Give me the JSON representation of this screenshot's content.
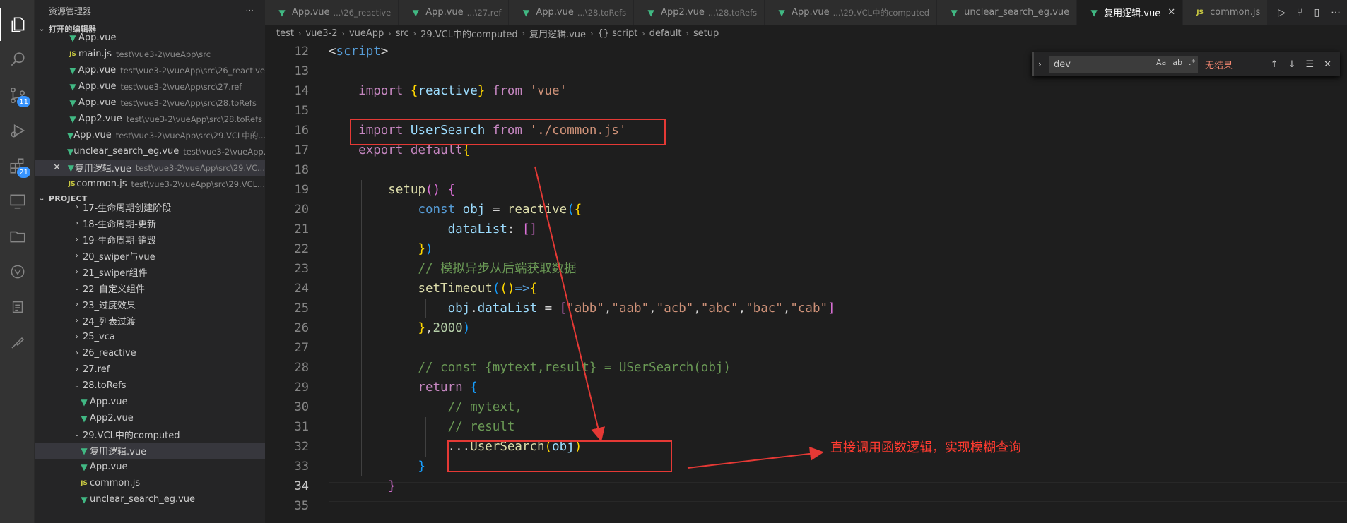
{
  "sidebar": {
    "title": "资源管理器",
    "more": "···",
    "open_editors_label": "打开的编辑器",
    "project_label": "PROJECT",
    "open_editors": [
      {
        "icon": "vue",
        "name": "App.vue",
        "desc": ""
      },
      {
        "icon": "js",
        "name": "main.js",
        "desc": "test\\vue3-2\\vueApp\\src"
      },
      {
        "icon": "vue",
        "name": "App.vue",
        "desc": "test\\vue3-2\\vueApp\\src\\26_reactive"
      },
      {
        "icon": "vue",
        "name": "App.vue",
        "desc": "test\\vue3-2\\vueApp\\src\\27.ref"
      },
      {
        "icon": "vue",
        "name": "App.vue",
        "desc": "test\\vue3-2\\vueApp\\src\\28.toRefs"
      },
      {
        "icon": "vue",
        "name": "App2.vue",
        "desc": "test\\vue3-2\\vueApp\\src\\28.toRefs"
      },
      {
        "icon": "vue",
        "name": "App.vue",
        "desc": "test\\vue3-2\\vueApp\\src\\29.VCL中的..."
      },
      {
        "icon": "vue",
        "name": "unclear_search_eg.vue",
        "desc": "test\\vue3-2\\vueApp..."
      },
      {
        "icon": "vue",
        "name": "复用逻辑.vue",
        "desc": "test\\vue3-2\\vueApp\\src\\29.VC..."
      },
      {
        "icon": "js",
        "name": "common.js",
        "desc": "test\\vue3-2\\vueApp\\src\\29.VCL..."
      }
    ],
    "project_items": [
      {
        "type": "folder",
        "name": "17-生命周期创建阶段",
        "indent": 1
      },
      {
        "type": "folder",
        "name": "18-生命周期-更新",
        "indent": 1
      },
      {
        "type": "folder",
        "name": "19-生命周期-销毁",
        "indent": 1
      },
      {
        "type": "folder",
        "name": "20_swiper与vue",
        "indent": 1
      },
      {
        "type": "folder",
        "name": "21_swiper组件",
        "indent": 1
      },
      {
        "type": "folder-open",
        "name": "22_自定义组件",
        "indent": 1
      },
      {
        "type": "folder",
        "name": "23_过度效果",
        "indent": 1
      },
      {
        "type": "folder",
        "name": "24_列表过渡",
        "indent": 1
      },
      {
        "type": "folder",
        "name": "25_vca",
        "indent": 1
      },
      {
        "type": "folder",
        "name": "26_reactive",
        "indent": 1
      },
      {
        "type": "folder",
        "name": "27.ref",
        "indent": 1
      },
      {
        "type": "folder-open",
        "name": "28.toRefs",
        "indent": 1
      },
      {
        "type": "vue",
        "name": "App.vue",
        "indent": 2
      },
      {
        "type": "vue",
        "name": "App2.vue",
        "indent": 2
      },
      {
        "type": "folder-open",
        "name": "29.VCL中的computed",
        "indent": 1
      },
      {
        "type": "vue",
        "name": "复用逻辑.vue",
        "indent": 2
      },
      {
        "type": "vue",
        "name": "App.vue",
        "indent": 2
      },
      {
        "type": "js",
        "name": "common.js",
        "indent": 2
      },
      {
        "type": "vue",
        "name": "unclear_search_eg.vue",
        "indent": 2
      }
    ]
  },
  "activity": {
    "scm_badge": "11",
    "ext_badge": "21"
  },
  "tabs": [
    {
      "icon": "vue",
      "name": "App.vue",
      "desc": "...\\26_reactive",
      "active": false
    },
    {
      "icon": "vue",
      "name": "App.vue",
      "desc": "...\\27.ref",
      "active": false
    },
    {
      "icon": "vue",
      "name": "App.vue",
      "desc": "...\\28.toRefs",
      "active": false
    },
    {
      "icon": "vue",
      "name": "App2.vue",
      "desc": "...\\28.toRefs",
      "active": false
    },
    {
      "icon": "vue",
      "name": "App.vue",
      "desc": "...\\29.VCL中的computed",
      "active": false
    },
    {
      "icon": "vue",
      "name": "unclear_search_eg.vue",
      "desc": "",
      "active": false
    },
    {
      "icon": "vue",
      "name": "复用逻辑.vue",
      "desc": "",
      "active": true,
      "close": "✕"
    },
    {
      "icon": "js",
      "name": "common.js",
      "desc": "",
      "active": false
    }
  ],
  "breadcrumb": [
    "test",
    "vue3-2",
    "vueApp",
    "src",
    "29.VCL中的computed",
    "复用逻辑.vue",
    "{} script",
    "default",
    "setup"
  ],
  "find": {
    "value": "dev",
    "result": "无结果",
    "opt_case": "Aa",
    "opt_word": "ab",
    "opt_regex": ".*"
  },
  "editor": {
    "line_numbers": [
      "12",
      "13",
      "14",
      "15",
      "16",
      "17",
      "18",
      "19",
      "20",
      "21",
      "22",
      "23",
      "24",
      "25",
      "26",
      "27",
      "28",
      "29",
      "30",
      "31",
      "32",
      "33",
      "34",
      "35"
    ],
    "current_line": "34",
    "lines": [
      [
        {
          "t": "w",
          "x": "<"
        },
        {
          "t": "kb",
          "x": "script"
        },
        {
          "t": "w",
          "x": ">"
        }
      ],
      [],
      [
        {
          "t": "w",
          "x": "    "
        },
        {
          "t": "k",
          "x": "import"
        },
        {
          "t": "w",
          "x": " "
        },
        {
          "t": "y",
          "x": "{"
        },
        {
          "t": "v",
          "x": "reactive"
        },
        {
          "t": "y",
          "x": "}"
        },
        {
          "t": "w",
          "x": " "
        },
        {
          "t": "k",
          "x": "from"
        },
        {
          "t": "w",
          "x": " "
        },
        {
          "t": "s",
          "x": "'vue'"
        }
      ],
      [],
      [
        {
          "t": "w",
          "x": "    "
        },
        {
          "t": "k",
          "x": "import"
        },
        {
          "t": "w",
          "x": " "
        },
        {
          "t": "v",
          "x": "UserSearch"
        },
        {
          "t": "w",
          "x": " "
        },
        {
          "t": "k",
          "x": "from"
        },
        {
          "t": "w",
          "x": " "
        },
        {
          "t": "s",
          "x": "'./common.js'"
        }
      ],
      [
        {
          "t": "w",
          "x": "    "
        },
        {
          "t": "k",
          "x": "export"
        },
        {
          "t": "w",
          "x": " "
        },
        {
          "t": "k",
          "x": "default"
        },
        {
          "t": "y",
          "x": "{"
        }
      ],
      [],
      [
        {
          "t": "w",
          "x": "        "
        },
        {
          "t": "f",
          "x": "setup"
        },
        {
          "t": "pk",
          "x": "()"
        },
        {
          "t": "w",
          "x": " "
        },
        {
          "t": "pk",
          "x": "{"
        }
      ],
      [
        {
          "t": "w",
          "x": "            "
        },
        {
          "t": "kb",
          "x": "const"
        },
        {
          "t": "w",
          "x": " "
        },
        {
          "t": "v",
          "x": "obj"
        },
        {
          "t": "w",
          "x": " = "
        },
        {
          "t": "f",
          "x": "reactive"
        },
        {
          "t": "b",
          "x": "("
        },
        {
          "t": "y",
          "x": "{"
        }
      ],
      [
        {
          "t": "w",
          "x": "                "
        },
        {
          "t": "v",
          "x": "dataList"
        },
        {
          "t": "w",
          "x": ": "
        },
        {
          "t": "pk",
          "x": "[]"
        }
      ],
      [
        {
          "t": "w",
          "x": "            "
        },
        {
          "t": "y",
          "x": "}"
        },
        {
          "t": "b",
          "x": ")"
        }
      ],
      [
        {
          "t": "w",
          "x": "            "
        },
        {
          "t": "c",
          "x": "// 模拟异步从后端获取数据"
        }
      ],
      [
        {
          "t": "w",
          "x": "            "
        },
        {
          "t": "f",
          "x": "setTimeout"
        },
        {
          "t": "b",
          "x": "("
        },
        {
          "t": "y",
          "x": "()"
        },
        {
          "t": "kb",
          "x": "=>"
        },
        {
          "t": "y",
          "x": "{"
        }
      ],
      [
        {
          "t": "w",
          "x": "                "
        },
        {
          "t": "v",
          "x": "obj"
        },
        {
          "t": "w",
          "x": "."
        },
        {
          "t": "v",
          "x": "dataList"
        },
        {
          "t": "w",
          "x": " = "
        },
        {
          "t": "pk",
          "x": "["
        },
        {
          "t": "s",
          "x": "\"abb\""
        },
        {
          "t": "w",
          "x": ","
        },
        {
          "t": "s",
          "x": "\"aab\""
        },
        {
          "t": "w",
          "x": ","
        },
        {
          "t": "s",
          "x": "\"acb\""
        },
        {
          "t": "w",
          "x": ","
        },
        {
          "t": "s",
          "x": "\"abc\""
        },
        {
          "t": "w",
          "x": ","
        },
        {
          "t": "s",
          "x": "\"bac\""
        },
        {
          "t": "w",
          "x": ","
        },
        {
          "t": "s",
          "x": "\"cab\""
        },
        {
          "t": "pk",
          "x": "]"
        }
      ],
      [
        {
          "t": "w",
          "x": "            "
        },
        {
          "t": "y",
          "x": "}"
        },
        {
          "t": "w",
          "x": ","
        },
        {
          "t": "n",
          "x": "2000"
        },
        {
          "t": "b",
          "x": ")"
        }
      ],
      [],
      [
        {
          "t": "w",
          "x": "            "
        },
        {
          "t": "c",
          "x": "// const {mytext,result} = USerSearch(obj)"
        }
      ],
      [
        {
          "t": "w",
          "x": "            "
        },
        {
          "t": "k",
          "x": "return"
        },
        {
          "t": "w",
          "x": " "
        },
        {
          "t": "b",
          "x": "{"
        }
      ],
      [
        {
          "t": "w",
          "x": "                "
        },
        {
          "t": "c",
          "x": "// mytext,"
        }
      ],
      [
        {
          "t": "w",
          "x": "                "
        },
        {
          "t": "c",
          "x": "// result"
        }
      ],
      [
        {
          "t": "w",
          "x": "                ..."
        },
        {
          "t": "f",
          "x": "UserSearch"
        },
        {
          "t": "y",
          "x": "("
        },
        {
          "t": "v",
          "x": "obj"
        },
        {
          "t": "y",
          "x": ")"
        }
      ],
      [
        {
          "t": "w",
          "x": "            "
        },
        {
          "t": "b",
          "x": "}"
        }
      ],
      [
        {
          "t": "w",
          "x": "        "
        },
        {
          "t": "pk",
          "x": "}"
        }
      ],
      []
    ]
  },
  "annotation": {
    "note": "直接调用函数逻辑，实现模糊查询",
    "color": "#e53935"
  }
}
